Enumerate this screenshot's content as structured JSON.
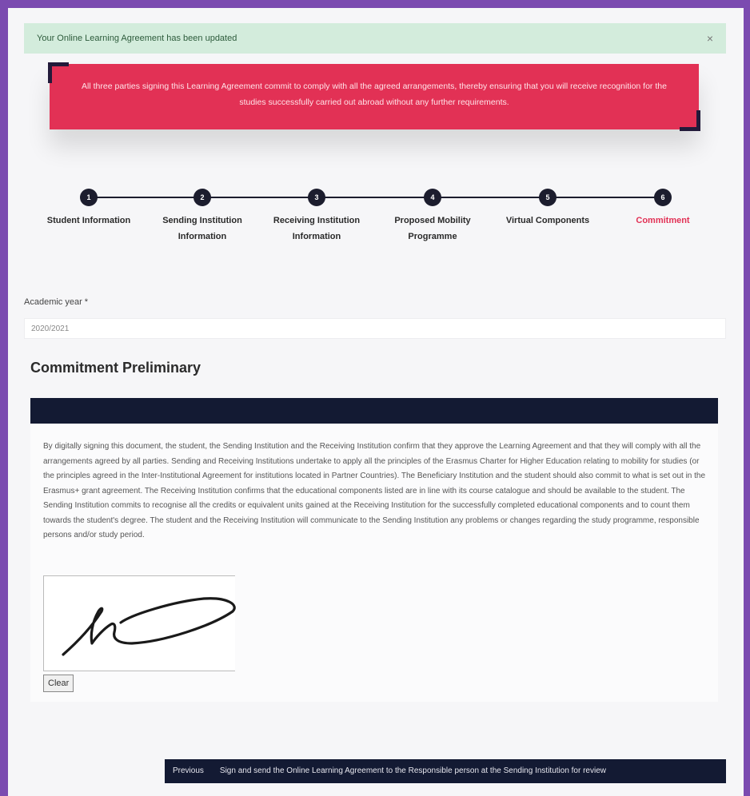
{
  "alert": {
    "message": "Your Online Learning Agreement has been updated",
    "close_label": "×"
  },
  "banner": {
    "text": "All three parties signing this Learning Agreement commit to comply with all the agreed arrangements, thereby ensuring that you will receive recognition for the studies successfully carried out abroad without any further requirements."
  },
  "stepper": {
    "steps": [
      {
        "number": "1",
        "label": "Student Information"
      },
      {
        "number": "2",
        "label": "Sending Institution Information"
      },
      {
        "number": "3",
        "label": "Receiving Institution Information"
      },
      {
        "number": "4",
        "label": "Proposed Mobility Programme"
      },
      {
        "number": "5",
        "label": "Virtual Components"
      },
      {
        "number": "6",
        "label": "Commitment"
      }
    ],
    "active_index": 5
  },
  "form": {
    "academic_year_label": "Academic year *",
    "academic_year_value": "2020/2021"
  },
  "section": {
    "title": "Commitment Preliminary"
  },
  "commitment": {
    "text": "By digitally signing this document, the student, the Sending Institution and the Receiving Institution confirm that they approve the Learning Agreement and that they will comply with all the arrangements agreed by all parties. Sending and Receiving Institutions undertake to apply all the principles of the Erasmus Charter for Higher Education relating to mobility for studies (or the principles agreed in the Inter-Institutional Agreement for institutions located in Partner Countries). The Beneficiary Institution and the student should also commit to what is set out in the Erasmus+ grant agreement. The Receiving Institution confirms that the educational components listed are in line with its course catalogue and should be available to the student. The Sending Institution commits to recognise all the credits or equivalent units gained at the Receiving Institution for the successfully completed educational components and to count them towards the student's degree. The student and the Receiving Institution will communicate to the Sending Institution any problems or changes regarding the study programme, responsible persons and/or study period.",
    "clear_label": "Clear"
  },
  "actions": {
    "previous_label": "Previous",
    "sign_label": "Sign and send the Online Learning Agreement to the Responsible person at the Sending Institution for review"
  },
  "colors": {
    "accent": "#e23155",
    "dark": "#131a33",
    "success_bg": "#d3ecdc",
    "frame": "#7b4bb0"
  }
}
